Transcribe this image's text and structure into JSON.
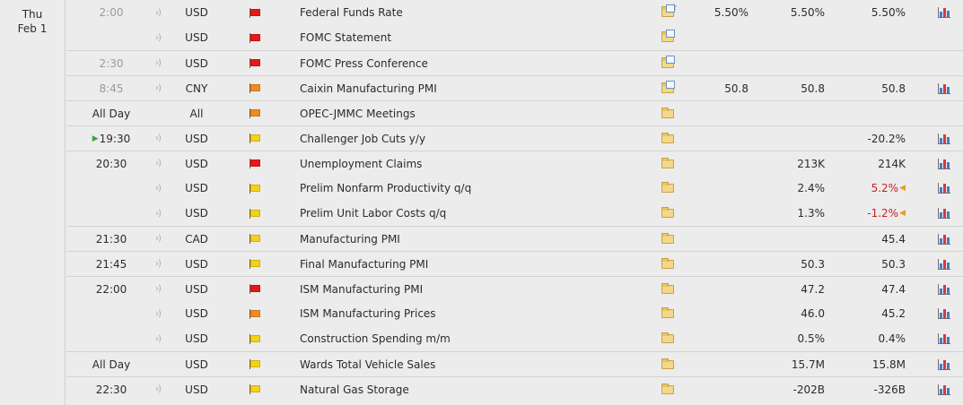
{
  "date": {
    "day": "Thu",
    "date": "Feb 1"
  },
  "colors": {
    "high": "#e81818",
    "medium": "#f08a24",
    "low": "#f2d21a"
  },
  "rows": [
    {
      "time": "2:00",
      "past": true,
      "current": false,
      "currency": "USD",
      "importance": "high",
      "event": "Federal Funds Rate",
      "folder": "doc-star",
      "actual": "5.50%",
      "forecast": "5.50%",
      "previous": "5.50%",
      "revised": false,
      "chart": true,
      "sep": false
    },
    {
      "time": "",
      "past": false,
      "current": false,
      "currency": "USD",
      "importance": "high",
      "event": "FOMC Statement",
      "folder": "doc",
      "actual": "",
      "forecast": "",
      "previous": "",
      "revised": false,
      "chart": false,
      "sep": false
    },
    {
      "time": "2:30",
      "past": true,
      "current": false,
      "currency": "USD",
      "importance": "high",
      "event": "FOMC Press Conference",
      "folder": "doc",
      "actual": "",
      "forecast": "",
      "previous": "",
      "revised": false,
      "chart": false,
      "sep": true
    },
    {
      "time": "8:45",
      "past": true,
      "current": false,
      "currency": "CNY",
      "importance": "medium",
      "event": "Caixin Manufacturing PMI",
      "folder": "doc",
      "actual": "50.8",
      "forecast": "50.8",
      "previous": "50.8",
      "revised": false,
      "chart": true,
      "sep": true
    },
    {
      "time": "All Day",
      "past": false,
      "current": false,
      "currency": "All",
      "importance": "medium",
      "event": "OPEC-JMMC Meetings",
      "folder": "plain",
      "actual": "",
      "forecast": "",
      "previous": "",
      "revised": false,
      "chart": false,
      "sep": true
    },
    {
      "time": "19:30",
      "past": false,
      "current": true,
      "currency": "USD",
      "importance": "low",
      "event": "Challenger Job Cuts y/y",
      "folder": "plain",
      "actual": "",
      "forecast": "",
      "previous": "-20.2%",
      "revised": false,
      "chart": true,
      "sep": true
    },
    {
      "time": "20:30",
      "past": false,
      "current": false,
      "currency": "USD",
      "importance": "high",
      "event": "Unemployment Claims",
      "folder": "plain",
      "actual": "",
      "forecast": "213K",
      "previous": "214K",
      "revised": false,
      "chart": true,
      "sep": true
    },
    {
      "time": "",
      "past": false,
      "current": false,
      "currency": "USD",
      "importance": "low",
      "event": "Prelim Nonfarm Productivity q/q",
      "folder": "plain",
      "actual": "",
      "forecast": "2.4%",
      "previous": "5.2%",
      "revised": true,
      "chart": true,
      "sep": false
    },
    {
      "time": "",
      "past": false,
      "current": false,
      "currency": "USD",
      "importance": "low",
      "event": "Prelim Unit Labor Costs q/q",
      "folder": "plain",
      "actual": "",
      "forecast": "1.3%",
      "previous": "-1.2%",
      "revised": true,
      "chart": true,
      "sep": false
    },
    {
      "time": "21:30",
      "past": false,
      "current": false,
      "currency": "CAD",
      "importance": "low",
      "event": "Manufacturing PMI",
      "folder": "plain",
      "actual": "",
      "forecast": "",
      "previous": "45.4",
      "revised": false,
      "chart": true,
      "sep": true
    },
    {
      "time": "21:45",
      "past": false,
      "current": false,
      "currency": "USD",
      "importance": "low",
      "event": "Final Manufacturing PMI",
      "folder": "plain",
      "actual": "",
      "forecast": "50.3",
      "previous": "50.3",
      "revised": false,
      "chart": true,
      "sep": true
    },
    {
      "time": "22:00",
      "past": false,
      "current": false,
      "currency": "USD",
      "importance": "high",
      "event": "ISM Manufacturing PMI",
      "folder": "plain",
      "actual": "",
      "forecast": "47.2",
      "previous": "47.4",
      "revised": false,
      "chart": true,
      "sep": true
    },
    {
      "time": "",
      "past": false,
      "current": false,
      "currency": "USD",
      "importance": "medium",
      "event": "ISM Manufacturing Prices",
      "folder": "plain",
      "actual": "",
      "forecast": "46.0",
      "previous": "45.2",
      "revised": false,
      "chart": true,
      "sep": false
    },
    {
      "time": "",
      "past": false,
      "current": false,
      "currency": "USD",
      "importance": "low",
      "event": "Construction Spending m/m",
      "folder": "plain",
      "actual": "",
      "forecast": "0.5%",
      "previous": "0.4%",
      "revised": false,
      "chart": true,
      "sep": false
    },
    {
      "time": "All Day",
      "past": false,
      "current": false,
      "currency": "USD",
      "importance": "low",
      "event": "Wards Total Vehicle Sales",
      "folder": "plain",
      "actual": "",
      "forecast": "15.7M",
      "previous": "15.8M",
      "revised": false,
      "chart": true,
      "sep": true
    },
    {
      "time": "22:30",
      "past": false,
      "current": false,
      "currency": "USD",
      "importance": "low",
      "event": "Natural Gas Storage",
      "folder": "plain",
      "actual": "",
      "forecast": "-202B",
      "previous": "-326B",
      "revised": false,
      "chart": true,
      "sep": true
    }
  ]
}
